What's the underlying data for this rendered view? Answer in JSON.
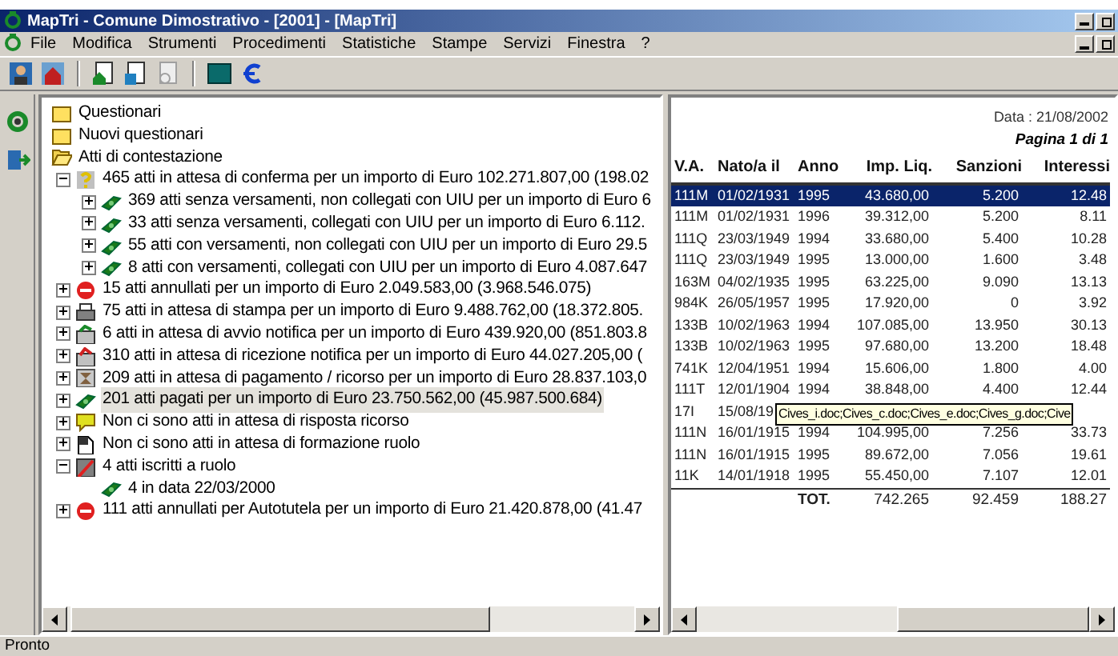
{
  "window": {
    "title": "MapTri - Comune Dimostrativo - [2001] - [MapTri]"
  },
  "menu": [
    "File",
    "Modifica",
    "Strumenti",
    "Procedimenti",
    "Statistiche",
    "Stampe",
    "Servizi",
    "Finestra",
    "?"
  ],
  "toolbar": [
    {
      "kind": "person",
      "disabled": false
    },
    {
      "kind": "house-person",
      "disabled": false
    },
    {
      "kind": "doc-home",
      "disabled": false
    },
    {
      "kind": "doc-arrow",
      "disabled": false
    },
    {
      "kind": "doc-search",
      "disabled": true
    },
    {
      "kind": "screen",
      "disabled": false
    },
    {
      "kind": "euro",
      "disabled": false
    }
  ],
  "side_toolbar": [
    {
      "kind": "refresh"
    },
    {
      "kind": "exit"
    }
  ],
  "tree": [
    {
      "label": "Questionari",
      "kind": "folder",
      "selected": false
    },
    {
      "label": "Nuovi questionari",
      "kind": "folder",
      "selected": false
    },
    {
      "label": "Atti di contestazione",
      "kind": "folder-open",
      "selected": false,
      "children": [
        {
          "label": "465 atti in attesa di conferma per un importo di Euro 102.271.807,00 (198.02",
          "kind": "question",
          "expanded": true,
          "selected": false,
          "children": [
            {
              "label": "369 atti senza versamenti, non collegati con UIU per un importo di Euro 6",
              "kind": "money",
              "expanded": false,
              "selected": false
            },
            {
              "label": "33 atti senza versamenti, collegati con UIU per un importo di Euro 6.112.",
              "kind": "money",
              "expanded": false,
              "selected": false
            },
            {
              "label": "55 atti con versamenti, non collegati con UIU per un importo di Euro 29.5",
              "kind": "money",
              "expanded": false,
              "selected": false
            },
            {
              "label": "8 atti con versamenti, collegati con UIU per un importo di Euro 4.087.647",
              "kind": "money",
              "expanded": false,
              "selected": false
            }
          ]
        },
        {
          "label": "15 atti annullati per un importo di Euro 2.049.583,00 (3.968.546.075)",
          "kind": "stop",
          "expanded": false,
          "selected": false
        },
        {
          "label": "75 atti in attesa di stampa per un importo di Euro 9.488.762,00 (18.372.805.",
          "kind": "printer",
          "expanded": false,
          "selected": false
        },
        {
          "label": "6 atti in attesa di avvio notifica per un importo di Euro 439.920,00 (851.803.8",
          "kind": "notify",
          "expanded": false,
          "selected": false
        },
        {
          "label": "310 atti in attesa di ricezione notifica per un importo di Euro 44.027.205,00 (",
          "kind": "notify-back",
          "expanded": false,
          "selected": false
        },
        {
          "label": "209 atti in attesa di pagamento / ricorso per un importo di Euro 28.837.103,0",
          "kind": "hourglass",
          "expanded": false,
          "selected": false
        },
        {
          "label": "201 atti pagati per un importo di Euro 23.750.562,00 (45.987.500.684)",
          "kind": "money",
          "expanded": false,
          "selected": true
        },
        {
          "label": "Non ci sono atti in attesa di risposta ricorso",
          "kind": "speech",
          "expanded": false,
          "selected": false
        },
        {
          "label": "Non ci sono atti in attesa di formazione ruolo",
          "kind": "document",
          "expanded": false,
          "selected": false
        },
        {
          "label": "4 atti iscritti a ruolo",
          "kind": "ruolo",
          "expanded": true,
          "selected": false,
          "children": [
            {
              "label": "4 in data 22/03/2000",
              "kind": "money",
              "selected": false
            }
          ]
        },
        {
          "label": "111 atti annullati per Autotutela per un importo di Euro 21.420.878,00 (41.47",
          "kind": "stop",
          "expanded": false,
          "selected": false
        }
      ]
    }
  ],
  "report": {
    "date": "Data : 21/08/2002",
    "page": "Pagina 1 di 1",
    "columns": [
      "V.A.",
      "Nato/a il",
      "Anno",
      "Imp. Liq.",
      "Sanzioni",
      "Interessi"
    ],
    "rows": [
      {
        "cells": [
          "111M",
          "01/02/1931",
          "1995",
          "43.680,00",
          "5.200",
          "12.48"
        ],
        "selected": true
      },
      {
        "cells": [
          "111M",
          "01/02/1931",
          "1996",
          "39.312,00",
          "5.200",
          "8.11"
        ],
        "selected": false
      },
      {
        "cells": [
          "111Q",
          "23/03/1949",
          "1994",
          "33.680,00",
          "5.400",
          "10.28"
        ],
        "selected": false
      },
      {
        "cells": [
          "111Q",
          "23/03/1949",
          "1995",
          "13.000,00",
          "1.600",
          "3.48"
        ],
        "selected": false
      },
      {
        "cells": [
          "163M",
          "04/02/1935",
          "1995",
          "63.225,00",
          "9.090",
          "13.13"
        ],
        "selected": false
      },
      {
        "cells": [
          "984K",
          "26/05/1957",
          "1995",
          "17.920,00",
          "0",
          "3.92"
        ],
        "selected": false
      },
      {
        "cells": [
          "133B",
          "10/02/1963",
          "1994",
          "107.085,00",
          "13.950",
          "30.13"
        ],
        "selected": false
      },
      {
        "cells": [
          "133B",
          "10/02/1963",
          "1995",
          "97.680,00",
          "13.200",
          "18.48"
        ],
        "selected": false
      },
      {
        "cells": [
          "741K",
          "12/04/1951",
          "1994",
          "15.606,00",
          "1.800",
          "4.00"
        ],
        "selected": false
      },
      {
        "cells": [
          "111T",
          "12/01/1904",
          "1994",
          "38.848,00",
          "4.400",
          "12.44"
        ],
        "selected": false
      },
      {
        "cells": [
          "17I",
          "15/08/19"
        ],
        "selected": false
      },
      {
        "cells": [
          "111N",
          "16/01/1915",
          "1994",
          "104.995,00",
          "7.256",
          "33.73"
        ],
        "selected": false
      },
      {
        "cells": [
          "111N",
          "16/01/1915",
          "1995",
          "89.672,00",
          "7.056",
          "19.61"
        ],
        "selected": false
      },
      {
        "cells": [
          "11K",
          "14/01/1918",
          "1995",
          "55.450,00",
          "7.107",
          "12.01"
        ],
        "selected": false
      }
    ],
    "total": {
      "label": "TOT.",
      "values": [
        "742.265",
        "92.459",
        "188.27"
      ]
    },
    "tooltip": "Cives_i.doc;Cives_c.doc;Cives_e.doc;Cives_g.doc;Cive"
  },
  "status_bar": "Pronto"
}
